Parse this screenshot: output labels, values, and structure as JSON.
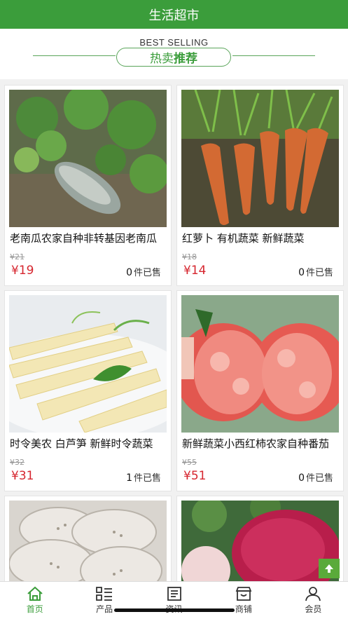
{
  "header": {
    "title": "生活超市"
  },
  "section": {
    "subtitle_en": "BEST SELLING",
    "title_prefix": "热卖",
    "title_suffix": "推荐"
  },
  "products": [
    {
      "name": "老南瓜农家自种非转基因老南瓜",
      "old_price": "¥21",
      "price": "¥19",
      "sold_count": "0",
      "sold_label": "件已售"
    },
    {
      "name": "红萝卜 有机蔬菜 新鲜蔬菜",
      "old_price": "¥18",
      "price": "¥14",
      "sold_count": "0",
      "sold_label": "件已售"
    },
    {
      "name": "时令美农 白芦笋 新鲜时令蔬菜",
      "old_price": "¥32",
      "price": "¥31",
      "sold_count": "1",
      "sold_label": "件已售"
    },
    {
      "name": "新鲜蔬菜小西红柿农家自种番茄",
      "old_price": "¥55",
      "price": "¥51",
      "sold_count": "0",
      "sold_label": "件已售"
    }
  ],
  "tabs": [
    {
      "label": "首页",
      "icon": "home-icon",
      "active": true
    },
    {
      "label": "产品",
      "icon": "grid-list-icon"
    },
    {
      "label": "资讯",
      "icon": "news-icon"
    },
    {
      "label": "商铺",
      "icon": "store-icon"
    },
    {
      "label": "会员",
      "icon": "user-icon"
    }
  ],
  "colors": {
    "primary": "#3b9d3b",
    "price": "#d6262f"
  }
}
